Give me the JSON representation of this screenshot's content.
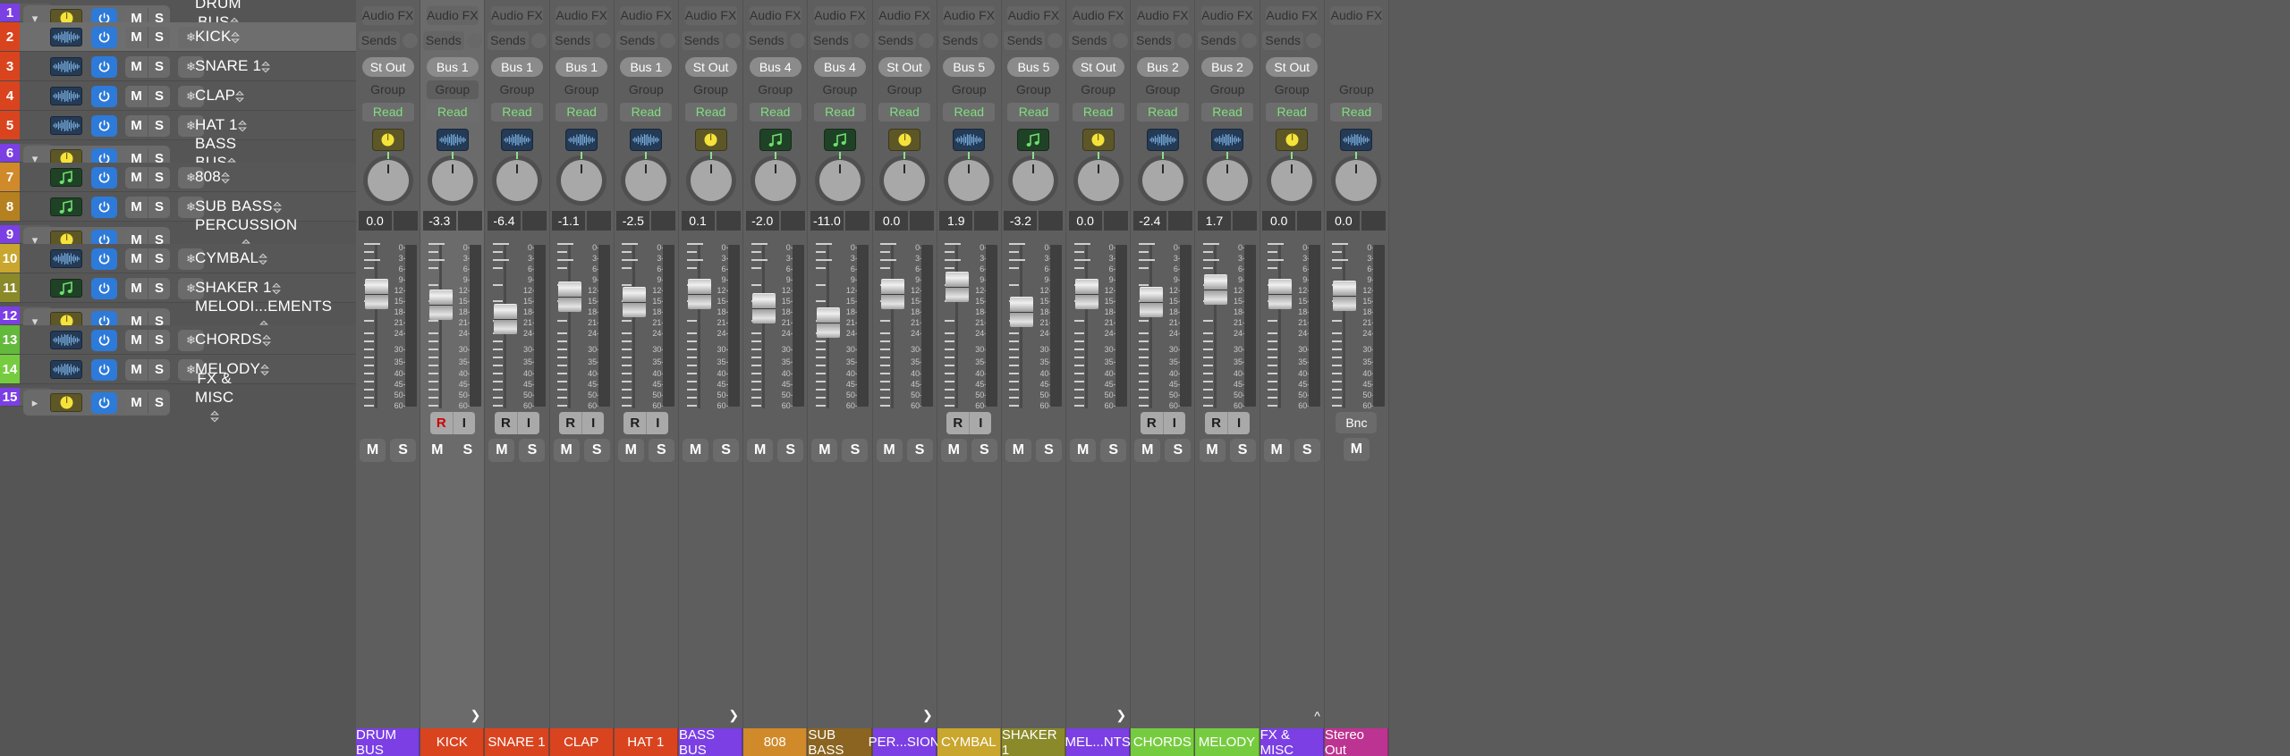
{
  "tracklist": {
    "tracks": [
      {
        "num": "1",
        "kind": "grp",
        "open": "chev-down",
        "icon": "aux",
        "name": "DRUM BUS",
        "type": "Aux",
        "freeze": false,
        "sel": false
      },
      {
        "num": "2",
        "kind": "sub",
        "open": "",
        "icon": "aud",
        "name": "KICK",
        "type": "Audio",
        "freeze": true,
        "sel": true
      },
      {
        "num": "3",
        "kind": "sub",
        "open": "",
        "icon": "aud",
        "name": "SNARE  1",
        "type": "Audio",
        "freeze": true,
        "sel": false
      },
      {
        "num": "4",
        "kind": "sub",
        "open": "",
        "icon": "aud",
        "name": "CLAP",
        "type": "Audio",
        "freeze": true,
        "sel": false
      },
      {
        "num": "5",
        "kind": "sub",
        "open": "",
        "icon": "aud",
        "name": "HAT 1",
        "type": "Audio",
        "freeze": true,
        "sel": false
      },
      {
        "num": "6",
        "kind": "grp",
        "open": "chev-down",
        "icon": "aux",
        "name": "BASS BUS",
        "type": "Aux",
        "freeze": false,
        "sel": false
      },
      {
        "num": "7",
        "kind": "sub",
        "open": "",
        "icon": "ins",
        "name": "808",
        "type": "Inst",
        "freeze": true,
        "sel": false
      },
      {
        "num": "8",
        "kind": "sub",
        "open": "",
        "icon": "ins",
        "name": "SUB BASS",
        "type": "Inst",
        "freeze": true,
        "sel": false
      },
      {
        "num": "9",
        "kind": "grp",
        "open": "chev-down",
        "icon": "aux",
        "name": "PERCUSSION",
        "type": "Aux",
        "freeze": false,
        "sel": false
      },
      {
        "num": "10",
        "kind": "sub",
        "open": "",
        "icon": "aud",
        "name": "CYMBAL",
        "type": "Audio",
        "freeze": true,
        "sel": false
      },
      {
        "num": "11",
        "kind": "sub",
        "open": "",
        "icon": "ins",
        "name": "SHAKER 1",
        "type": "Inst",
        "freeze": true,
        "sel": false
      },
      {
        "num": "12",
        "kind": "grp",
        "open": "chev-down",
        "icon": "aux",
        "name": "MELODI...EMENTS",
        "type": "Aux",
        "freeze": false,
        "sel": false
      },
      {
        "num": "13",
        "kind": "sub",
        "open": "",
        "icon": "aud",
        "name": "CHORDS",
        "type": "Audio",
        "freeze": true,
        "sel": false
      },
      {
        "num": "14",
        "kind": "sub",
        "open": "",
        "icon": "aud",
        "name": "MELODY",
        "type": "Audio",
        "freeze": true,
        "sel": false
      },
      {
        "num": "15",
        "kind": "grp",
        "open": "chev-right",
        "icon": "aux",
        "name": "FX & MISC",
        "type": "Aux",
        "freeze": false,
        "sel": false
      }
    ],
    "number_colors": [
      "#7b3fe4",
      "#d9441f",
      "#d9441f",
      "#d9441f",
      "#d9441f",
      "#7b3fe4",
      "#d08a2a",
      "#b5801f",
      "#7b3fe4",
      "#c9a62e",
      "#8a8a2a",
      "#7b3fe4",
      "#63b93a",
      "#76cc3f",
      "#7b3fe4"
    ],
    "mute_label": "M",
    "solo_label": "S",
    "freeze_icon": "snowflake-icon",
    "power_icon": "power-icon"
  },
  "mixer": {
    "labels": {
      "audio_fx": "Audio FX",
      "sends": "Sends",
      "group": "Group",
      "automation": "Read",
      "mute": "M",
      "solo": "S",
      "record": "R",
      "input": "I",
      "bounce": "Bnc"
    },
    "meter_scale": [
      "0",
      "3",
      "6",
      "9",
      "12",
      "15",
      "18",
      "21",
      "24",
      "30",
      "35",
      "40",
      "45",
      "50",
      "60"
    ],
    "strips": [
      {
        "name": "DRUM BUS",
        "icon": "aux",
        "out": "St Out",
        "vol": "0.0",
        "plate": "DRUM BUS",
        "plate_color": "#7b3fe4",
        "fader": 0.28,
        "ri": false,
        "sel": false,
        "bnc": false,
        "arrow": ""
      },
      {
        "name": "KICK",
        "icon": "aud",
        "out": "Bus 1",
        "vol": "-3.3",
        "plate": "KICK",
        "plate_color": "#d9441f",
        "fader": 0.38,
        "ri": true,
        "ri_armed": true,
        "sel": true,
        "bnc": false,
        "arrow": "chev-right"
      },
      {
        "name": "SNARE 1",
        "icon": "aud",
        "out": "Bus 1",
        "vol": "-6.4",
        "plate": "SNARE  1",
        "plate_color": "#d9441f",
        "fader": 0.52,
        "ri": true,
        "ri_armed": false,
        "sel": false,
        "bnc": false,
        "arrow": ""
      },
      {
        "name": "CLAP",
        "icon": "aud",
        "out": "Bus 1",
        "vol": "-1.1",
        "plate": "CLAP",
        "plate_color": "#d9441f",
        "fader": 0.31,
        "ri": true,
        "ri_armed": false,
        "sel": false,
        "bnc": false,
        "arrow": ""
      },
      {
        "name": "HAT 1",
        "icon": "aud",
        "out": "Bus 1",
        "vol": "-2.5",
        "plate": "HAT 1",
        "plate_color": "#d9441f",
        "fader": 0.36,
        "ri": true,
        "ri_armed": false,
        "sel": false,
        "bnc": false,
        "arrow": ""
      },
      {
        "name": "BASS BUS",
        "icon": "aux",
        "out": "St Out",
        "vol": "0.1",
        "plate": "BASS BUS",
        "plate_color": "#7b3fe4",
        "fader": 0.28,
        "ri": false,
        "sel": false,
        "bnc": false,
        "arrow": "chev-right"
      },
      {
        "name": "808",
        "icon": "ins",
        "out": "Bus 4",
        "vol": "-2.0",
        "plate": "808",
        "plate_color": "#d08a2a",
        "fader": 0.42,
        "ri": false,
        "sel": false,
        "bnc": false,
        "arrow": ""
      },
      {
        "name": "SUB BASS",
        "icon": "ins",
        "out": "Bus 4",
        "vol": "-11.0",
        "plate": "SUB BASS",
        "plate_color": "#8a6420",
        "fader": 0.55,
        "ri": false,
        "sel": false,
        "bnc": false,
        "arrow": ""
      },
      {
        "name": "PERCUSSION",
        "icon": "aux",
        "out": "St Out",
        "vol": "0.0",
        "plate": "PER...SION",
        "plate_color": "#7b3fe4",
        "fader": 0.28,
        "ri": false,
        "sel": false,
        "bnc": false,
        "arrow": "chev-right"
      },
      {
        "name": "CYMBAL",
        "icon": "aud",
        "out": "Bus 5",
        "vol": "1.9",
        "plate": "CYMBAL",
        "plate_color": "#c9a62e",
        "fader": 0.22,
        "ri": true,
        "ri_armed": false,
        "sel": false,
        "bnc": false,
        "arrow": ""
      },
      {
        "name": "SHAKER 1",
        "icon": "ins",
        "out": "Bus 5",
        "vol": "-3.2",
        "plate": "SHAKER 1",
        "plate_color": "#8a8a2a",
        "fader": 0.45,
        "ri": false,
        "sel": false,
        "bnc": false,
        "arrow": ""
      },
      {
        "name": "MELODIC ELEMENTS",
        "icon": "aux",
        "out": "St Out",
        "vol": "0.0",
        "plate": "MEL...NTS",
        "plate_color": "#7b3fe4",
        "fader": 0.28,
        "ri": false,
        "sel": false,
        "bnc": false,
        "arrow": "chev-right"
      },
      {
        "name": "CHORDS",
        "icon": "aud",
        "out": "Bus 2",
        "vol": "-2.4",
        "plate": "CHORDS",
        "plate_color": "#76cc3f",
        "fader": 0.36,
        "ri": true,
        "ri_armed": false,
        "sel": false,
        "bnc": false,
        "arrow": ""
      },
      {
        "name": "MELODY",
        "icon": "aud",
        "out": "Bus 2",
        "vol": "1.7",
        "plate": "MELODY",
        "plate_color": "#76cc3f",
        "fader": 0.24,
        "ri": true,
        "ri_armed": false,
        "sel": false,
        "bnc": false,
        "arrow": ""
      },
      {
        "name": "FX & MISC",
        "icon": "aux",
        "out": "St Out",
        "vol": "0.0",
        "plate": "FX & MISC",
        "plate_color": "#7b3fe4",
        "fader": 0.28,
        "ri": false,
        "sel": false,
        "bnc": false,
        "arrow": "chev-up"
      },
      {
        "name": "Stereo Out",
        "icon": "aud",
        "out": "",
        "vol": "0.0",
        "plate": "Stereo Out",
        "plate_color": "#bd3391",
        "fader": 0.3,
        "ri": false,
        "sel": false,
        "bnc": true,
        "arrow": "",
        "only_mute": true,
        "no_sends": true
      }
    ]
  }
}
